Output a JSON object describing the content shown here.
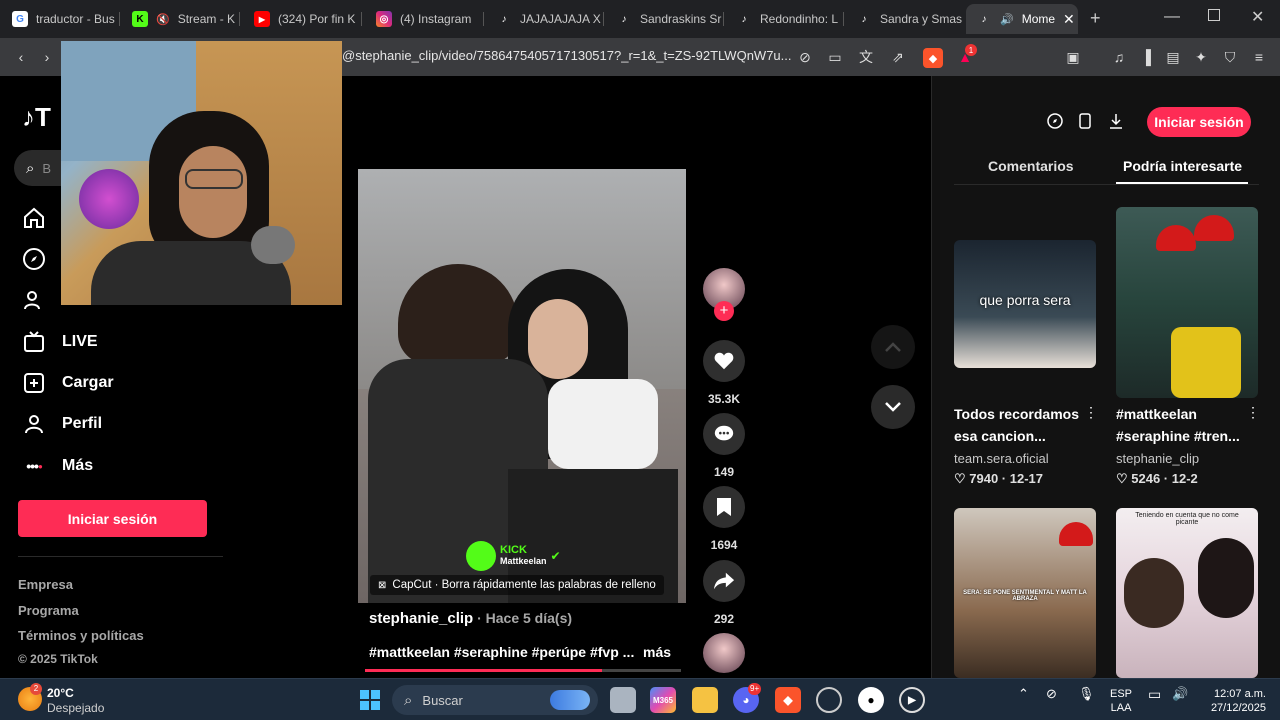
{
  "browser": {
    "tabs": [
      {
        "label": "traductor - Bus",
        "icon": "google-icon",
        "color": "#4285f4"
      },
      {
        "label": "Stream - K",
        "icon": "kick-icon",
        "color": "#53fc18"
      },
      {
        "label": "(324) Por fin K",
        "icon": "youtube-icon",
        "color": "#ff0000"
      },
      {
        "label": "(4) Instagram",
        "icon": "instagram-icon",
        "color": "#e1306c"
      },
      {
        "label": "JAJAJAJAJA X",
        "icon": "tiktok-icon",
        "color": "#ffffff"
      },
      {
        "label": "Sandraskins Sr",
        "icon": "tiktok-icon",
        "color": "#ffffff"
      },
      {
        "label": "Redondinho: L",
        "icon": "tiktok-icon",
        "color": "#ffffff"
      },
      {
        "label": "Sandra y Smas",
        "icon": "tiktok-icon",
        "color": "#ffffff"
      },
      {
        "label": "Mome",
        "icon": "tiktok-icon",
        "color": "#ffffff"
      }
    ],
    "url": "@stephanie_clip/video/7586475405717130517?_r=1&_t=ZS-92TLWQnW7u...",
    "badge_count": "1"
  },
  "nav": {
    "search_placeholder": "B",
    "live": "LIVE",
    "upload": "Cargar",
    "profile": "Perfil",
    "more": "Más",
    "login": "Iniciar sesión",
    "footer": {
      "company": "Empresa",
      "program": "Programa",
      "terms": "Términos y políticas",
      "copyright": "© 2025 TikTok"
    }
  },
  "video": {
    "capcut_text": "CapCut · Borra rápidamente las palabras de relleno",
    "kick_label": "KICK",
    "kick_user": "Mattkeelan",
    "author": "stephanie_clip",
    "time": " · Hace 5 día(s)",
    "hashtags": "#mattkeelan #seraphine #perúpe #fvp ...",
    "more": "más",
    "likes": "35.3K",
    "comments": "149",
    "saves": "1694",
    "shares": "292"
  },
  "right": {
    "login": "Iniciar sesión",
    "tab_comments": "Comentarios",
    "tab_suggested": "Podría interesarte",
    "cards": [
      {
        "title1": "Todos recordamos",
        "title2": "esa cancion...",
        "user": "team.sera.oficial",
        "stats": "♡ 7940 · 12-17",
        "overlay": "que porra sera"
      },
      {
        "title1": "#mattkeelan",
        "title2": "#seraphine #tren...",
        "user": "stephanie_clip",
        "stats": "♡ 5246 · 12-2",
        "overlay": ""
      },
      {
        "overlay": "SERA: SE PONE SENTIMENTAL Y MATT LA ABRAZA"
      },
      {
        "overlay": "Teniendo en cuenta que no come picante"
      }
    ]
  },
  "taskbar": {
    "weather_temp": "20°C",
    "weather_desc": "Despejado",
    "weather_badge": "2",
    "search": "Buscar",
    "lang1": "ESP",
    "lang2": "LAA",
    "time": "12:07 a.m.",
    "date": "27/12/2025",
    "discord_badge": "9+"
  },
  "colors": {
    "accent": "#fe2c55",
    "panel": "#121212",
    "taskbar": "#1c2a3a"
  }
}
